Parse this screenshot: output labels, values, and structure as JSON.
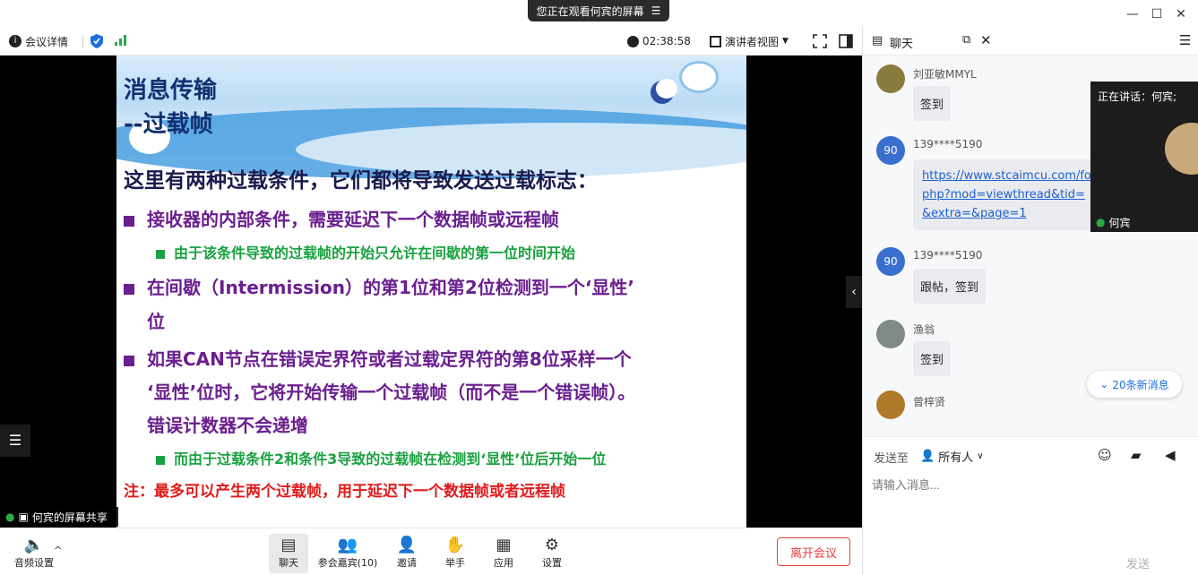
{
  "banner": {
    "text": "您正在观看何宾的屏幕",
    "menu_icon": "menu-icon"
  },
  "window_controls": {
    "minimize": "—",
    "maximize": "☐",
    "close": "✕"
  },
  "toolbar": {
    "meeting_details": "会议详情",
    "timer": "02:38:58",
    "view_mode": "演讲者视图"
  },
  "slide": {
    "title_line1": "消息传输",
    "title_line2": "--过载帧",
    "intro": "这里有两种过载条件，它们都将导致发送过载标志：",
    "bullet1": "接收器的内部条件，需要延迟下一个数据帧或远程帧",
    "sub1": "由于该条件导致的过载帧的开始只允许在间歇的第一位时间开始",
    "bullet2_line1": "在间歇（Intermission）的第1位和第2位检测到一个‘显性’",
    "bullet2_line2": "位",
    "bullet3_line1": "如果CAN节点在错误定界符或者过载定界符的第8位采样一个",
    "bullet3_line2": "‘显性’位时，它将开始传输一个过载帧（而不是一个错误帧）。",
    "bullet3_line3": "错误计数器不会递增",
    "sub2": "而由于过载条件2和条件3导致的过载帧在检测到‘显性’位后开始一位",
    "note": "注：最多可以产生两个过载帧，用于延迟下一个数据帧或者远程帧",
    "colors": {
      "title": "#123070",
      "dark": "#1b1b4f",
      "purple": "#6a1f8f",
      "green": "#1aa140",
      "red": "#e01a1a"
    }
  },
  "sharing_label": "何宾的屏幕共享",
  "bottombar": {
    "audio": "音频设置",
    "chat": "聊天",
    "participants": "参会嘉宾(10)",
    "invite": "邀请",
    "raise_hand": "举手",
    "apps": "应用",
    "settings": "设置",
    "leave": "离开会议"
  },
  "chat": {
    "title": "聊天",
    "messages": [
      {
        "sender": "刘亚敏MMYL",
        "text": "签到",
        "avatar": ""
      },
      {
        "sender": "139****5190",
        "avatar": "90",
        "link_line1": "https://www.stcaimcu.com/fo",
        "link_line2": "php?mod=viewthread&tid=",
        "link_line3": "&extra=&page=1"
      },
      {
        "sender": "139****5190",
        "text": "跟帖，签到",
        "avatar": "90"
      },
      {
        "sender": "渔翁",
        "text": "签到",
        "avatar": ""
      },
      {
        "sender": "曾梓贤",
        "avatar": ""
      }
    ],
    "speaking_label": "正在讲话：何宾;",
    "speaker_name": "何宾",
    "new_messages": "20条新消息",
    "send_to_label": "发送至",
    "recipient": "所有人",
    "input_placeholder": "请输入消息...",
    "send": "发送"
  }
}
